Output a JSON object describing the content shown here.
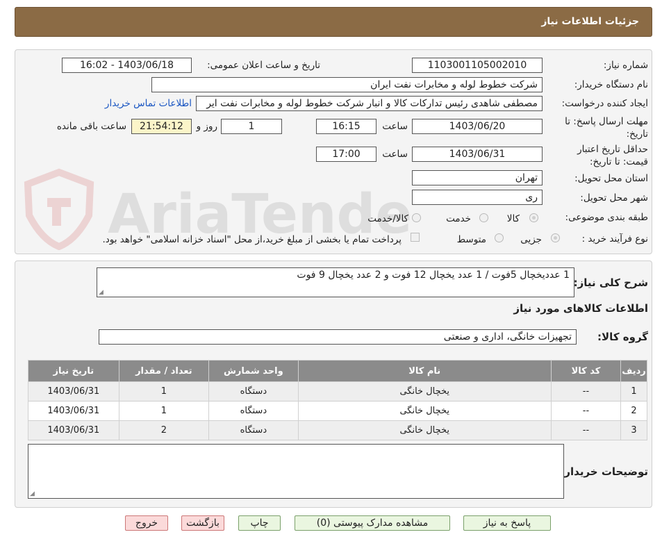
{
  "header": {
    "title": "جزئیات اطلاعات نیاز"
  },
  "watermark": {
    "text": "AriaTender.neT"
  },
  "form": {
    "need_number_label": "شماره نیاز:",
    "need_number": "1103001105002010",
    "announce_label": "تاریخ و ساعت اعلان عمومی:",
    "announce_value": "1403/06/18 - 16:02",
    "buyer_org_label": "نام دستگاه خریدار:",
    "buyer_org": "شرکت خطوط لوله و مخابرات نفت ایران",
    "creator_label": "ایجاد کننده درخواست:",
    "creator": "مصطفی  شاهدی رئیس تدارکات کالا و انبار شرکت خطوط لوله و مخابرات نفت ایر",
    "contact_link": "اطلاعات تماس خریدار",
    "reply_deadline_label": "مهلت ارسال پاسخ: تا تاریخ:",
    "reply_date": "1403/06/20",
    "time_label": "ساعت",
    "reply_time": "16:15",
    "days_value": "1",
    "days_label": "روز و",
    "remaining_time": "21:54:12",
    "remaining_label": "ساعت باقی مانده",
    "validity_label": "حداقل تاریخ اعتبار قیمت: تا تاریخ:",
    "validity_date": "1403/06/31",
    "validity_time": "17:00",
    "province_label": "استان محل تحویل:",
    "province": "تهران",
    "city_label": "شهر محل تحویل:",
    "city": "ری",
    "category_label": "طبقه بندی موضوعی:",
    "category_options": [
      "کالا",
      "خدمت",
      "کالا/خدمت"
    ],
    "category_selected": "کالا",
    "process_label": "نوع فرآیند خرید :",
    "process_options": [
      "جزیی",
      "متوسط"
    ],
    "payment_note": "پرداخت تمام یا بخشی از مبلغ خرید،از محل \"اسناد خزانه اسلامی\" خواهد بود."
  },
  "description": {
    "label": "شرح کلی نیاز:",
    "value": "1 عدديخچال 5فوت / 1 عدد يخچال 12 فوت و 2 عدد يخچال 9 فوت",
    "goods_info_title": "اطلاعات کالاهای مورد نیاز",
    "group_label": "گروه کالا:",
    "group_value": "تجهیزات خانگی، اداری و صنعتی"
  },
  "table": {
    "headers": [
      "ردیف",
      "کد کالا",
      "نام کالا",
      "واحد شمارش",
      "تعداد / مقدار",
      "تاریخ نیاز"
    ],
    "rows": [
      {
        "row": "1",
        "code": "--",
        "name": "یخچال خانگی",
        "unit": "دستگاه",
        "qty": "1",
        "date": "1403/06/31"
      },
      {
        "row": "2",
        "code": "--",
        "name": "یخچال خانگی",
        "unit": "دستگاه",
        "qty": "1",
        "date": "1403/06/31"
      },
      {
        "row": "3",
        "code": "--",
        "name": "یخچال خانگی",
        "unit": "دستگاه",
        "qty": "2",
        "date": "1403/06/31"
      }
    ]
  },
  "buyer_notes": {
    "label": "توضیحات خریدار:",
    "value": ""
  },
  "buttons": {
    "reply": "پاسخ به نیاز",
    "attachments": "مشاهده مدارک پیوستی (0)",
    "print": "چاپ",
    "back": "بازگشت",
    "exit": "خروج"
  },
  "colors": {
    "header_bg": "#8b6b45",
    "table_header_bg": "#8b8b8b",
    "button_bg": "#eaf6e0",
    "danger_button_bg": "#fbdada",
    "link": "#1a56c2"
  }
}
